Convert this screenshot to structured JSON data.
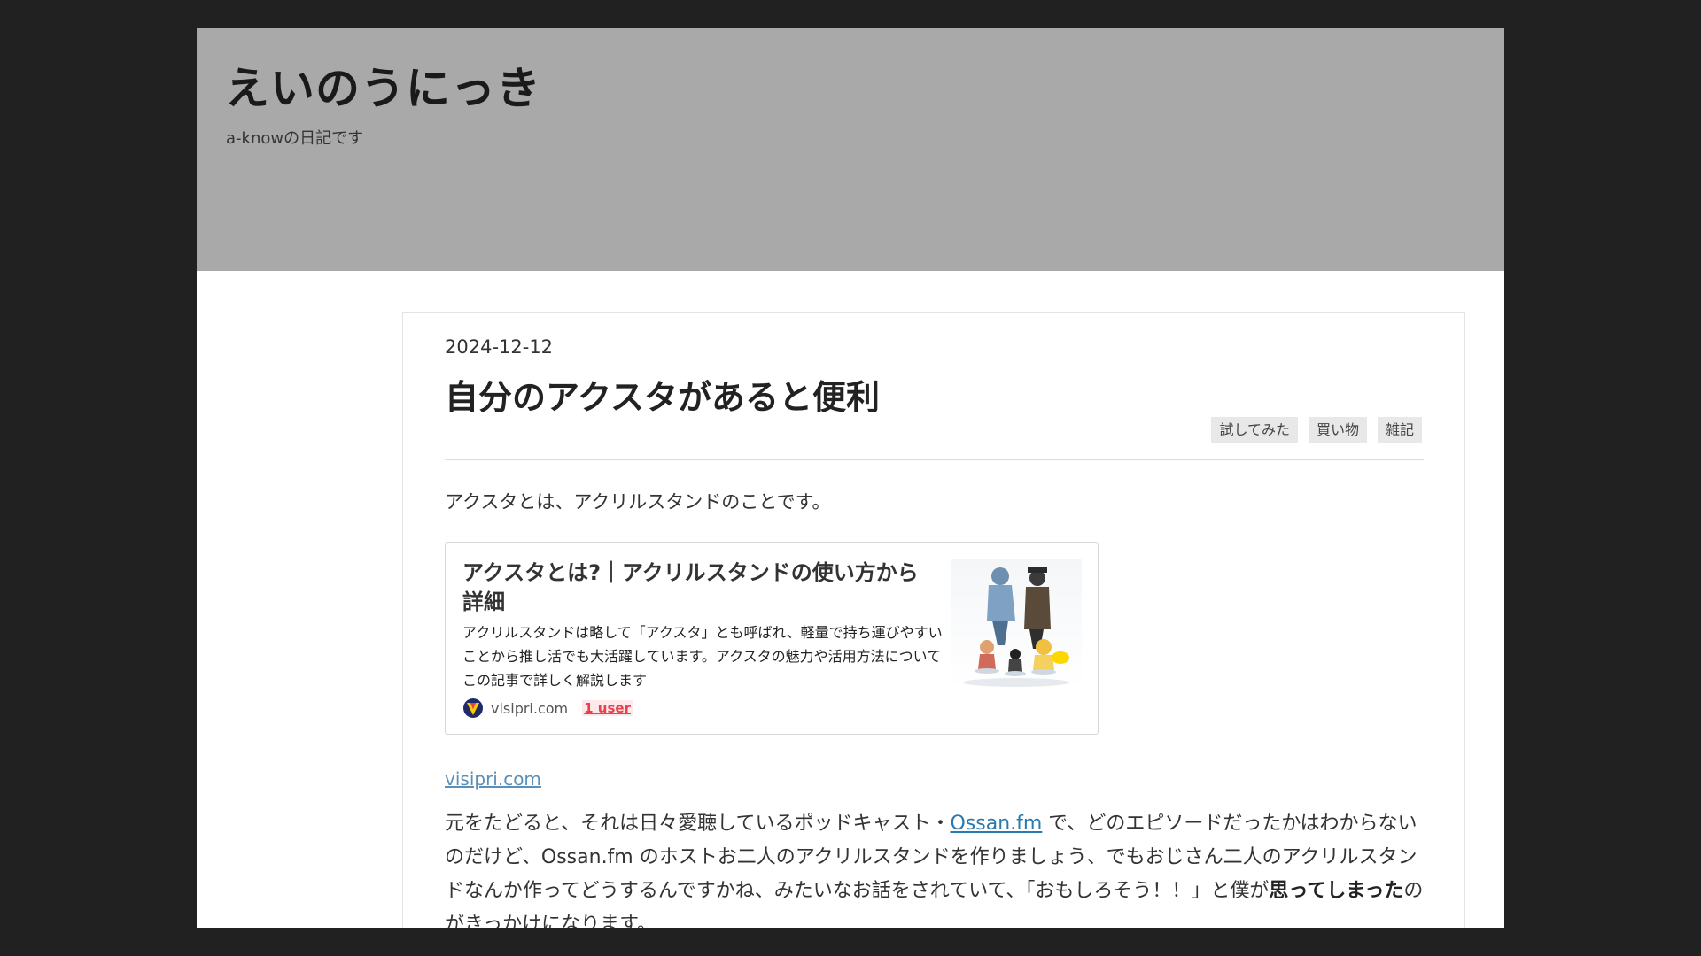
{
  "blog": {
    "title": "えいのうにっき",
    "description": "a-knowの日記です"
  },
  "entry": {
    "date": "2024-12-12",
    "title": "自分のアクスタがあると便利",
    "categories": [
      "試してみた",
      "買い物",
      "雑記"
    ],
    "intro": "アクスタとは、アクリルスタンドのことです。",
    "embed": {
      "title": "アクスタとは?｜アクリルスタンドの使い方から詳細",
      "description": "アクリルスタンドは略して「アクスタ」とも呼ばれ、軽量で持ち運びやすいことから推し活でも大活躍しています。アクスタの魅力や活用方法についてこの記事で詳しく解説します",
      "site": "visipri.com",
      "users": "1 user"
    },
    "source_link": "visipri.com",
    "paragraph": {
      "part1": "元をたどると、それは日々愛聴しているポッドキャスト・",
      "link": "Ossan.fm",
      "part2": " で、どのエピソードだったかはわからないのだけど、Ossan.fm のホストお二人のアクリルスタンドを作りましょう、でもおじさん二人のアクリルスタンドなんか作ってどうするんですかね、みたいなお話をされていて、「おもしろそう！！」と僕が",
      "bold": "思ってしまった",
      "part3": "のがきっかけになります。"
    }
  },
  "colors": {
    "background": "#212121",
    "header": "#a9a9a9",
    "link": "#2a7ab0",
    "users_badge": "#e8414e"
  }
}
